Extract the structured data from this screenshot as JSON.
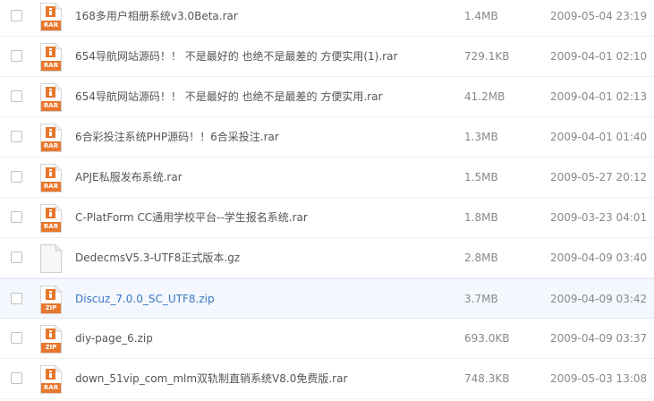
{
  "files": [
    {
      "name": "168多用户相册系统v3.0Beta.rar",
      "size": "1.4MB",
      "date": "2009-05-04 23:19",
      "icon": "rar-archive-icon",
      "type_label": "RAR"
    },
    {
      "name": "654导航网站源码！！ 不是最好的 也绝不是最差的 方便实用(1).rar",
      "size": "729.1KB",
      "date": "2009-04-01 02:10",
      "icon": "rar-archive-icon",
      "type_label": "RAR"
    },
    {
      "name": "654导航网站源码！！ 不是最好的 也绝不是最差的 方便实用.rar",
      "size": "41.2MB",
      "date": "2009-04-01 02:13",
      "icon": "rar-archive-icon",
      "type_label": "RAR"
    },
    {
      "name": "6合彩投注系统PHP源码！！6合采投注.rar",
      "size": "1.3MB",
      "date": "2009-04-01 01:40",
      "icon": "rar-archive-icon",
      "type_label": "RAR"
    },
    {
      "name": "APJE私服发布系统.rar",
      "size": "1.5MB",
      "date": "2009-05-27 20:12",
      "icon": "rar-archive-icon",
      "type_label": "RAR"
    },
    {
      "name": "C-PlatForm CC通用学校平台--学生报名系统.rar",
      "size": "1.8MB",
      "date": "2009-03-23 04:01",
      "icon": "rar-archive-icon",
      "type_label": "RAR"
    },
    {
      "name": "DedecmsV5.3-UTF8正式版本.gz",
      "size": "2.8MB",
      "date": "2009-04-09 03:40",
      "icon": "generic-file-icon",
      "type_label": ""
    },
    {
      "name": "Discuz_7.0.0_SC_UTF8.zip",
      "size": "3.7MB",
      "date": "2009-04-09 03:42",
      "icon": "zip-archive-icon",
      "type_label": "ZIP"
    },
    {
      "name": "diy-page_6.zip",
      "size": "693.0KB",
      "date": "2009-04-09 03:37",
      "icon": "zip-archive-icon",
      "type_label": "ZIP"
    },
    {
      "name": "down_51vip_com_mlm双轨制直销系统V8.0免费版.rar",
      "size": "748.3KB",
      "date": "2009-05-03 13:08",
      "icon": "rar-archive-icon",
      "type_label": "RAR"
    }
  ],
  "hover_row_index": 7,
  "colors": {
    "archive_orange": "#e8762b",
    "link_blue": "#3b77c4",
    "hover_bg": "#f4f8fe"
  }
}
